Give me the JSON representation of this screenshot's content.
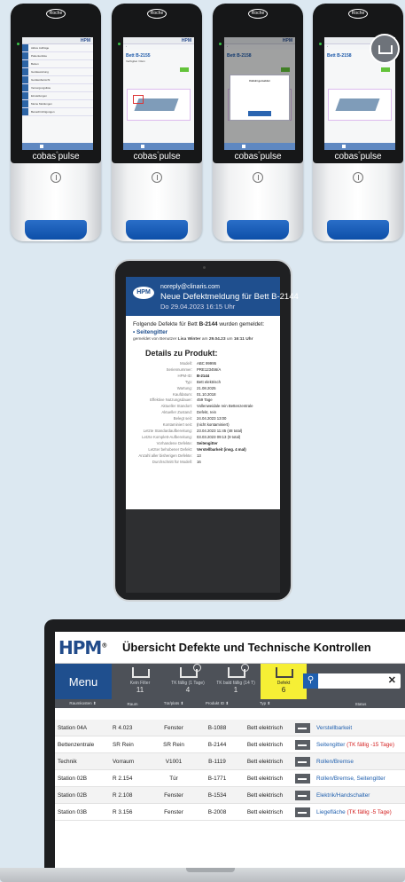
{
  "phones": [
    {
      "brand": "cobas",
      "brand_sup": "pulse",
      "logo": "Roche",
      "screen": "menu",
      "menu_items": [
        "Aktive Aufträge",
        "Patientenliste",
        "Betten",
        "Gerätewartung",
        "Geräteübersicht",
        "Versorgungsliste",
        "Einstellungen",
        "Meine Meldungen",
        "Benachrichtigungen"
      ]
    },
    {
      "brand": "cobas",
      "brand_sup": "pulse",
      "logo": "Roche",
      "screen": "bed",
      "bed_title": "Bett B-2155",
      "bed_sub": "Verfügbar / Rein"
    },
    {
      "brand": "cobas",
      "brand_sup": "pulse",
      "logo": "Roche",
      "screen": "dialog",
      "bed_title": "Bett B-2158",
      "dialog_title": "Defekt gemeldet"
    },
    {
      "brand": "cobas",
      "brand_sup": "pulse",
      "logo": "Roche",
      "screen": "bed-icon",
      "bed_title": "Bett B-2158"
    }
  ],
  "email": {
    "from": "noreply@clinaris.com",
    "subject": "Neue Defektmeldung für Bett B-2144",
    "date": "Do 29.04.2023  16:15 Uhr",
    "logo": "HPM",
    "intro_prefix": "Folgende Defekte für Bett ",
    "intro_bed": "B-2144",
    "intro_suffix": " wurden gemeldet:",
    "bullet": "• Seitengitter",
    "reported_prefix": "gemeldet von Benutzer ",
    "reported_user": "Lisa Winter",
    "reported_mid": " am ",
    "reported_date": "29.04.23",
    "reported_at": " um ",
    "reported_time": "16:11 Uhr",
    "details_title": "Details zu Produkt:",
    "details": [
      {
        "k": "Modell:",
        "v": "ABC 99995"
      },
      {
        "k": "Seriennummer:",
        "v": "PRE123456/A"
      },
      {
        "k": "HPM-ID:",
        "v": "B-2144"
      },
      {
        "k": "Typ:",
        "v": "Bett elektrisch"
      },
      {
        "k": "Wartung:",
        "v": "21.08.2025"
      },
      {
        "k": "Kaufdatum:",
        "v": "01.10.2018"
      },
      {
        "k": "Effektive Nutzungsdauer:",
        "v": "459 Tage"
      },
      {
        "k": "Aktueller Standort:",
        "v": "Vollenweidale rein Bettenzentrale"
      },
      {
        "k": "Aktueller Zustand:",
        "v": "Defekt, rein"
      },
      {
        "k": "Belegt seit:",
        "v": "24.04.2023  13:00"
      },
      {
        "k": "Kontaminiert seit:",
        "v": "(nicht kontaminiert)"
      },
      {
        "k": "Letzte Standardaufbereitung:",
        "v": "23.04.2023  11:45  (48 total)"
      },
      {
        "k": "Letzte Komplett-Aufbereitung:",
        "v": "03.03.2023 09:13  (9 total)"
      },
      {
        "k": "Vorhandene Defekte:",
        "v": "Seitengitter"
      },
      {
        "k": "Letzter behobener Defekt:",
        "v": "Verstellbarkeit (insg. 4 mal)"
      },
      {
        "k": "Anzahl aller bisherigen Defekte:",
        "v": "13"
      },
      {
        "k": "Durchschnitt für Modell:",
        "v": "16"
      }
    ]
  },
  "app": {
    "logo": "HPM",
    "logo_mark": "®",
    "title": "Übersicht Defekte und Technische Kontrollen",
    "menu_label": "Menu",
    "filters": [
      {
        "label": "Kein Filter",
        "count": "11",
        "active": false,
        "clock": false
      },
      {
        "label": "TK fällig (1 Tage)",
        "count": "4",
        "active": false,
        "clock": true
      },
      {
        "label": "TK bald fällig (14 T)",
        "count": "1",
        "active": false,
        "clock": true
      },
      {
        "label": "Defekt",
        "count": "6",
        "active": true,
        "clock": false
      }
    ],
    "search_icon": "search-icon",
    "search_value": "",
    "search_clear": "✕",
    "columns": [
      "Raumkosten ⬍",
      "Raum",
      "Tür/plats ⬍",
      "Produkt ID ⬍",
      "Typ ⬍",
      "",
      "Status"
    ],
    "rows": [
      {
        "station": "Station 04A",
        "room": "R 4.023",
        "place": "Fenster",
        "id": "B-1088",
        "type": "Bett elektrisch",
        "status": "Verstellbarkeit",
        "note": ""
      },
      {
        "station": "Bettenzentrale",
        "room": "SR Rein",
        "place": "SR Rein",
        "id": "B-2144",
        "type": "Bett elektrisch",
        "status": "Seitengitter",
        "note": "(TK fällig -15 Tage)"
      },
      {
        "station": "Technik",
        "room": "Vorraum",
        "place": "V1001",
        "id": "B-1119",
        "type": "Bett elektrisch",
        "status": "Rollen/Bremse",
        "note": ""
      },
      {
        "station": "Station 02B",
        "room": "R 2.154",
        "place": "Tür",
        "id": "B-1771",
        "type": "Bett elektrisch",
        "status": "Rollen/Bremse, Seitengitter",
        "note": ""
      },
      {
        "station": "Station 02B",
        "room": "R 2.108",
        "place": "Fenster",
        "id": "B-1534",
        "type": "Bett elektrisch",
        "status": "Elektrik/Handschalter",
        "note": ""
      },
      {
        "station": "Station 03B",
        "room": "R 3.156",
        "place": "Fenster",
        "id": "B-2008",
        "type": "Bett elektrisch",
        "status": "Liegefläche",
        "note": "(TK fällig -5 Tage)"
      }
    ]
  },
  "colors": {
    "brand_blue": "#1f4f8e",
    "active_filter": "#f6ef35",
    "link_blue": "#1f5fae",
    "alert_red": "#d42323",
    "background": "#dce8f1"
  }
}
